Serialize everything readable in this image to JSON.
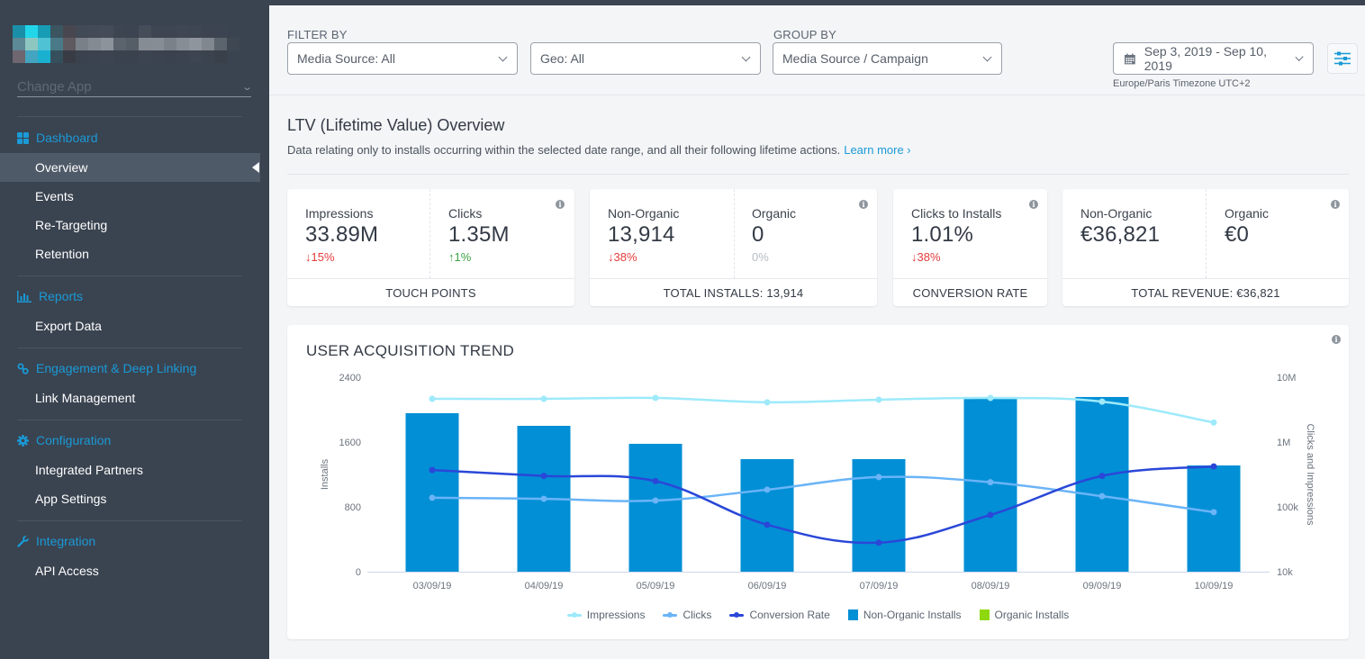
{
  "sidebar": {
    "app_selector": {
      "placeholder": "Change App"
    },
    "sections": [
      {
        "title": "Dashboard",
        "icon": "grid-icon",
        "items": [
          {
            "label": "Overview",
            "active": true
          },
          {
            "label": "Events"
          },
          {
            "label": "Re-Targeting"
          },
          {
            "label": "Retention"
          }
        ]
      },
      {
        "title": "Reports",
        "icon": "bar-chart-icon",
        "items": [
          {
            "label": "Export Data"
          }
        ]
      },
      {
        "title": "Engagement & Deep Linking",
        "icon": "link-icon",
        "items": [
          {
            "label": "Link Management"
          }
        ]
      },
      {
        "title": "Configuration",
        "icon": "gear-icon",
        "items": [
          {
            "label": "Integrated Partners"
          },
          {
            "label": "App Settings"
          }
        ]
      },
      {
        "title": "Integration",
        "icon": "wrench-icon",
        "items": [
          {
            "label": "API Access"
          }
        ]
      }
    ]
  },
  "filters": {
    "filter_by_label": "FILTER BY",
    "media_source": "Media Source: All",
    "geo": "Geo: All",
    "group_by_label": "GROUP BY",
    "group_by": "Media Source / Campaign",
    "date_range": "Sep 3, 2019 - Sep 10, 2019",
    "timezone": "Europe/Paris Timezone UTC+2"
  },
  "overview": {
    "title": "LTV (Lifetime Value) Overview",
    "description": "Data relating only to installs occurring within the selected date range, and all their following lifetime actions.",
    "learn_more": "Learn more ›"
  },
  "cards": {
    "touch_points": {
      "footer": "TOUCH POINTS",
      "impressions": {
        "label": "Impressions",
        "value": "33.89M",
        "change": "↓15%",
        "trend": "down"
      },
      "clicks": {
        "label": "Clicks",
        "value": "1.35M",
        "change": "↑1%",
        "trend": "up"
      }
    },
    "installs": {
      "footer": "TOTAL INSTALLS: 13,914",
      "non_organic": {
        "label": "Non-Organic",
        "value": "13,914",
        "change": "↓38%",
        "trend": "down"
      },
      "organic": {
        "label": "Organic",
        "value": "0",
        "change": "0%",
        "trend": "flat"
      }
    },
    "conversion": {
      "footer": "CONVERSION RATE",
      "clicks_to_installs": {
        "label": "Clicks to Installs",
        "value": "1.01%",
        "change": "↓38%",
        "trend": "down"
      }
    },
    "revenue": {
      "footer": "TOTAL REVENUE: €36,821",
      "non_organic": {
        "label": "Non-Organic",
        "value": "€36,821"
      },
      "organic": {
        "label": "Organic",
        "value": "€0"
      }
    }
  },
  "colors": {
    "accent": "#1a9ad6",
    "impressions": "#9eeafb",
    "clicks": "#6ab4f7",
    "conversion_rate": "#2a47d8",
    "non_organic_installs": "#028fd5",
    "organic_installs": "#8fd80f",
    "down": "#e53b3b",
    "up": "#3ca142"
  },
  "chart_data": {
    "type": "bar",
    "title": "USER ACQUISITION TREND",
    "categories": [
      "03/09/19",
      "04/09/19",
      "05/09/19",
      "06/09/19",
      "07/09/19",
      "08/09/19",
      "09/09/19",
      "10/09/19"
    ],
    "ylabel": "Installs",
    "ylim": [
      0,
      2400
    ],
    "yticks": [
      "0",
      "800",
      "1600",
      "2400"
    ],
    "y2label": "Clicks and Impressions",
    "y2scale": "log",
    "y2lim": [
      10000,
      10000000
    ],
    "y2ticks": [
      "10k",
      "100k",
      "1M",
      "10M"
    ],
    "series": [
      {
        "name": "Non-Organic Installs",
        "type": "bar",
        "axis": "left",
        "values": [
          1956,
          1800,
          1578,
          1389,
          1389,
          2156,
          2156,
          1311
        ]
      },
      {
        "name": "Organic Installs",
        "type": "bar",
        "axis": "left",
        "values": [
          0,
          0,
          0,
          0,
          0,
          0,
          0,
          0
        ]
      },
      {
        "name": "Impressions",
        "type": "line",
        "axis": "right",
        "values": [
          4640000,
          4640000,
          4790000,
          4100000,
          4500000,
          4790000,
          4200000,
          2000000
        ]
      },
      {
        "name": "Clicks",
        "type": "line",
        "axis": "right",
        "values": [
          138000,
          133000,
          125000,
          184000,
          288000,
          240000,
          146000,
          83000
        ]
      },
      {
        "name": "Conversion Rate",
        "type": "line",
        "axis": "right",
        "values": [
          370000,
          300000,
          250000,
          53000,
          28000,
          75000,
          300000,
          420000
        ]
      }
    ],
    "legend": [
      "Impressions",
      "Clicks",
      "Conversion Rate",
      "Non-Organic Installs",
      "Organic Installs"
    ],
    "legend_position": "bottom",
    "grid": false
  }
}
